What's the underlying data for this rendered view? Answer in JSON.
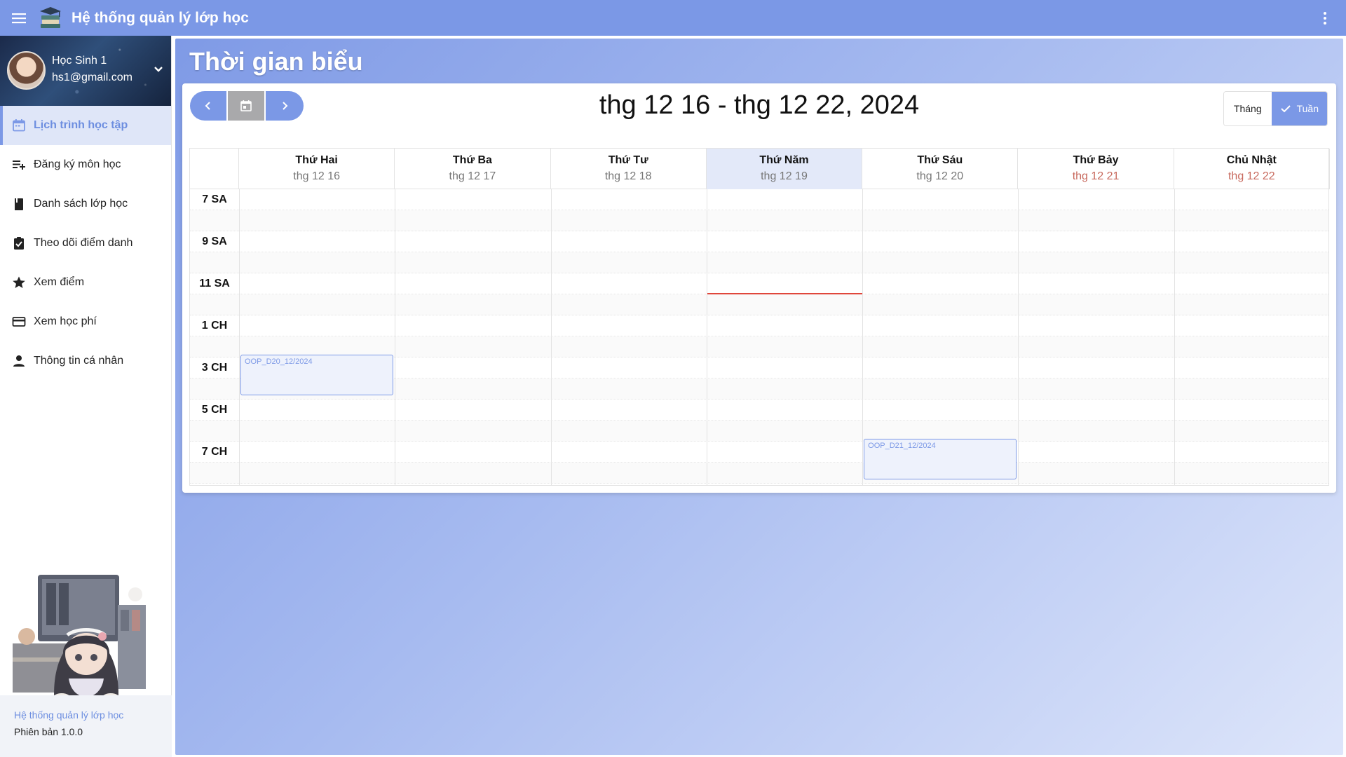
{
  "app": {
    "title": "Hệ thống quản lý lớp học"
  },
  "user": {
    "name": "Học Sinh 1",
    "email": "hs1@gmail.com"
  },
  "sidebar": {
    "items": [
      {
        "label": "Lịch trình học tập",
        "icon": "calendar-icon",
        "active": true
      },
      {
        "label": "Đăng ký môn học",
        "icon": "playlist-add-icon",
        "active": false
      },
      {
        "label": "Danh sách lớp học",
        "icon": "book-icon",
        "active": false
      },
      {
        "label": "Theo dõi điểm danh",
        "icon": "clipboard-check-icon",
        "active": false
      },
      {
        "label": "Xem điểm",
        "icon": "star-icon",
        "active": false
      },
      {
        "label": "Xem học phí",
        "icon": "credit-card-icon",
        "active": false
      },
      {
        "label": "Thông tin cá nhân",
        "icon": "person-icon",
        "active": false
      }
    ],
    "footer": {
      "title": "Hệ thống quản lý lớp học",
      "version": "Phiên bản 1.0.0"
    }
  },
  "page": {
    "title": "Thời gian biểu"
  },
  "calendar": {
    "range": "thg 12 16 - thg 12 22, 2024",
    "views": {
      "month": "Tháng",
      "week": "Tuần",
      "selected": "Tuần"
    },
    "days": [
      {
        "name": "Thứ Hai",
        "date": "thg 12 16",
        "today": false,
        "weekend": false
      },
      {
        "name": "Thứ Ba",
        "date": "thg 12 17",
        "today": false,
        "weekend": false
      },
      {
        "name": "Thứ Tư",
        "date": "thg 12 18",
        "today": false,
        "weekend": false
      },
      {
        "name": "Thứ Năm",
        "date": "thg 12 19",
        "today": true,
        "weekend": false
      },
      {
        "name": "Thứ Sáu",
        "date": "thg 12 20",
        "today": false,
        "weekend": false
      },
      {
        "name": "Thứ Bảy",
        "date": "thg 12 21",
        "today": false,
        "weekend": true
      },
      {
        "name": "Chủ Nhật",
        "date": "thg 12 22",
        "today": false,
        "weekend": true
      }
    ],
    "time_labels": [
      "7 SA",
      "9 SA",
      "11 SA",
      "1 CH",
      "3 CH",
      "5 CH",
      "7 CH"
    ],
    "events": [
      {
        "title": "OOP_D20_12/2024",
        "day": "Thứ Hai",
        "start": "3 CH",
        "end": "5 CH"
      },
      {
        "title": "OOP_D21_12/2024",
        "day": "Thứ Sáu",
        "start": "7 CH",
        "end": "9 CH"
      }
    ]
  },
  "colors": {
    "primary": "#7b98e6",
    "today_column": "#e3e9f9",
    "weekend_date": "#c86a5e",
    "now_indicator": "#e0473c"
  }
}
